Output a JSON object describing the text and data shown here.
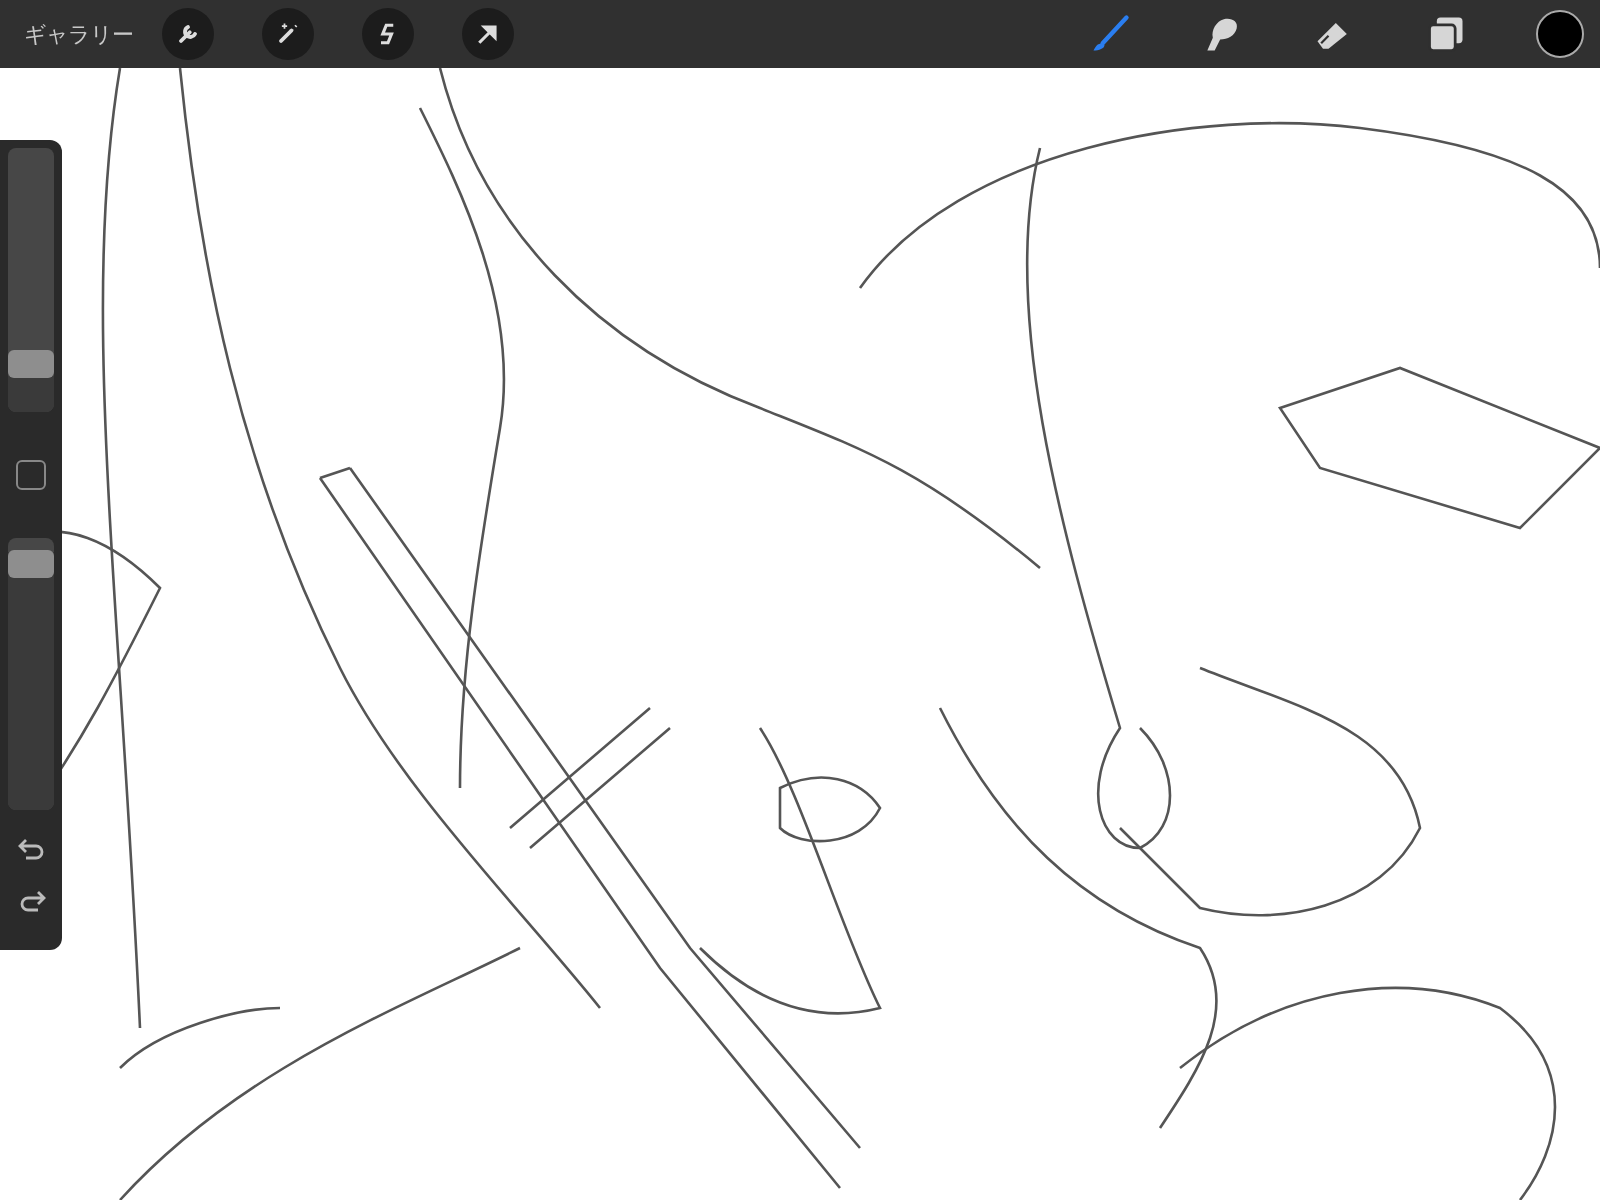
{
  "top_bar": {
    "gallery_label": "ギャラリー",
    "actions": [
      {
        "kind": "wrench"
      },
      {
        "kind": "wand"
      },
      {
        "kind": "selection"
      },
      {
        "kind": "move"
      }
    ],
    "tools": [
      {
        "kind": "brush",
        "selected": true
      },
      {
        "kind": "smudge",
        "selected": false
      },
      {
        "kind": "eraser",
        "selected": false
      },
      {
        "kind": "layers",
        "selected": false
      }
    ],
    "current_color": {
      "color": "#000000"
    }
  },
  "sidebar": {
    "size_slider": {
      "level": 0.14
    },
    "opacity_slider": {
      "level": 0.95
    }
  }
}
